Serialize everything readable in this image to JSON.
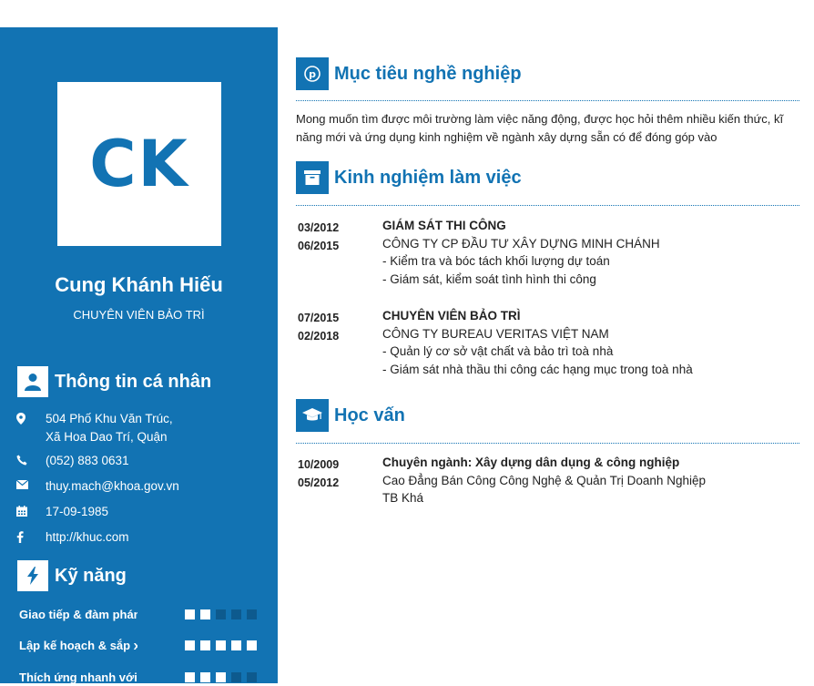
{
  "profile": {
    "initials": "CK",
    "name": "Cung Khánh Hiếu",
    "role": "CHUYÊN VIÊN BẢO TRÌ"
  },
  "personal": {
    "title": "Thông tin cá nhân",
    "address_line1": "504 Phố Khu Văn Trúc,",
    "address_line2": "Xã Hoa Dao Trí, Quận",
    "phone": "(052) 883 0631",
    "email": "thuy.mach@khoa.gov.vn",
    "birthday": "17-09-1985",
    "website": "http://khuc.com"
  },
  "skills": {
    "title": "Kỹ năng",
    "items": [
      {
        "label": "Giao tiếp & đàm phán",
        "level": 2,
        "max": 5
      },
      {
        "label": "Lập kế hoạch & sắp xếp",
        "level": 5,
        "max": 5
      },
      {
        "label": "Thích ứng nhanh với",
        "level": 3,
        "max": 5
      }
    ]
  },
  "objective": {
    "title": "Mục tiêu nghề nghiệp",
    "text": "Mong muốn tìm được môi trường làm việc năng động, được học hỏi thêm nhiều kiến thức, kĩ năng mới và ứng dụng kinh nghiệm về ngành xây dựng sẵn có để đóng góp vào"
  },
  "experience": {
    "title": "Kinh nghiệm làm việc",
    "items": [
      {
        "start": "03/2012",
        "end": "06/2015",
        "position": "GIÁM SÁT THI CÔNG",
        "company": "CÔNG TY CP ĐẦU TƯ XÂY DỰNG MINH CHÁNH",
        "duty1": "- Kiểm tra và bóc tách khối lượng dự toán",
        "duty2": "- Giám sát, kiểm soát tình hình thi công"
      },
      {
        "start": "07/2015",
        "end": "02/2018",
        "position": "CHUYÊN VIÊN BẢO TRÌ",
        "company": "CÔNG TY BUREAU VERITAS VIỆT NAM",
        "duty1": "- Quản lý cơ sở vật chất và bảo trì toà nhà",
        "duty2": "- Giám sát nhà thầu thi công các hạng mục trong toà nhà"
      }
    ]
  },
  "education": {
    "title": "Học vấn",
    "items": [
      {
        "start": "10/2009",
        "end": "05/2012",
        "major": "Chuyên ngành: Xây dựng dân dụng & công nghiệp",
        "school": "Cao Đẳng Bán Công Công Nghệ & Quản Trị Doanh Nghiệp",
        "grade": "TB Khá"
      }
    ]
  },
  "colors": {
    "primary": "#1273b3",
    "dot_off": "#0d5a8e"
  }
}
